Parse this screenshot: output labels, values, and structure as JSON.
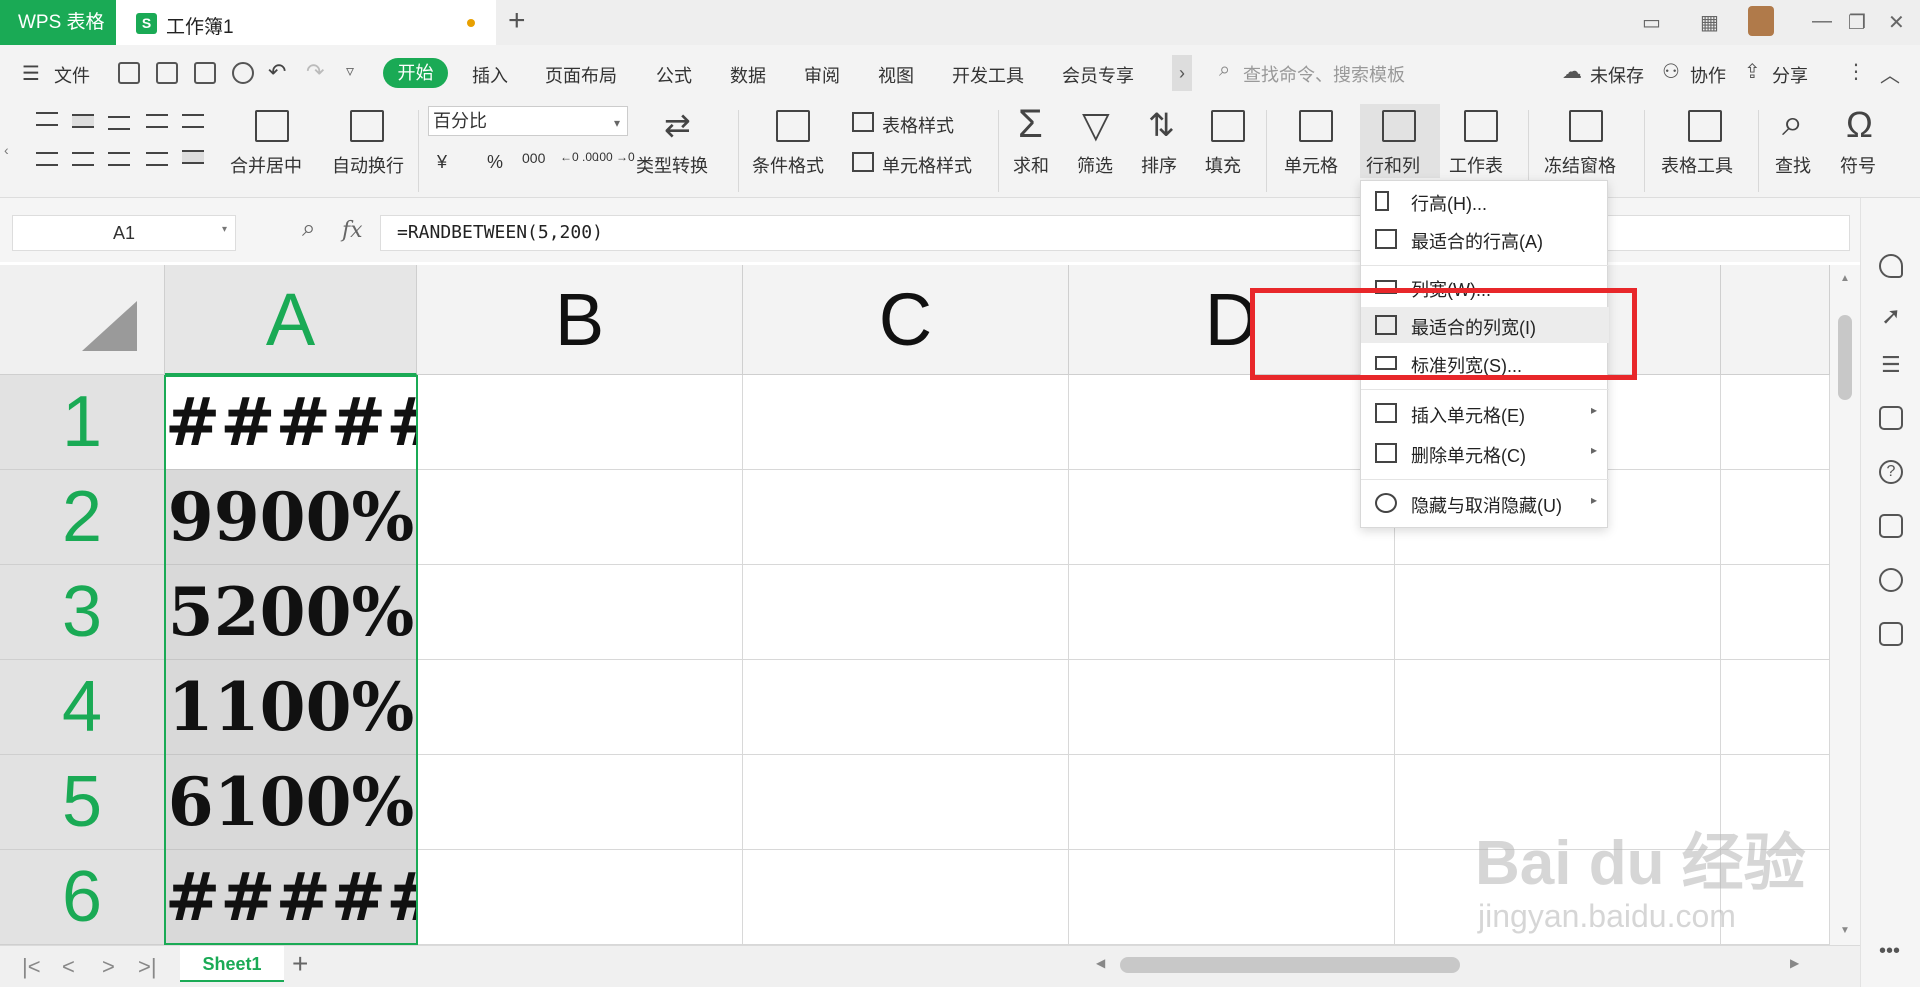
{
  "titlebar": {
    "app_label": "WPS 表格",
    "doc_icon_letter": "S",
    "doc_name": "工作簿1",
    "new_tab": "+"
  },
  "menu": {
    "file": "文件",
    "tabs": [
      "开始",
      "插入",
      "页面布局",
      "公式",
      "数据",
      "审阅",
      "视图",
      "开发工具",
      "会员专享"
    ],
    "more": "›",
    "search_placeholder": "查找命令、搜索模板",
    "unsaved": "未保存",
    "collab": "协作",
    "share": "分享"
  },
  "ribbon": {
    "merge_center": "合并居中",
    "auto_wrap": "自动换行",
    "number_format": "百分比",
    "currency": "¥",
    "percent": "%",
    "thousands": "000",
    "inc_decimal": "←0 .00",
    "dec_decimal": ".00 →0",
    "type_convert": "类型转换",
    "conditional_format": "条件格式",
    "table_style": "表格样式",
    "cell_style": "单元格样式",
    "sum": "求和",
    "filter": "筛选",
    "sort": "排序",
    "fill": "填充",
    "cell": "单元格",
    "row_col": "行和列",
    "worksheet": "工作表",
    "freeze": "冻结窗格",
    "table_tools": "表格工具",
    "find": "查找",
    "symbol": "符号"
  },
  "formula_bar": {
    "cell_ref": "A1",
    "fx": "fx",
    "formula": "=RANDBETWEEN(5,200)"
  },
  "grid": {
    "columns": [
      "A",
      "B",
      "C",
      "D"
    ],
    "rows": [
      {
        "num": "1",
        "a": "#####"
      },
      {
        "num": "2",
        "a": "9900%"
      },
      {
        "num": "3",
        "a": "5200%"
      },
      {
        "num": "4",
        "a": "1100%"
      },
      {
        "num": "5",
        "a": "6100%"
      },
      {
        "num": "6",
        "a": "#####"
      }
    ]
  },
  "dropdown": {
    "items": [
      {
        "label": "行高(H)...",
        "submenu": false
      },
      {
        "label": "最适合的行高(A)",
        "submenu": false
      },
      {
        "label": "列宽(W)...",
        "submenu": false
      },
      {
        "label": "最适合的列宽(I)",
        "submenu": false
      },
      {
        "label": "标准列宽(S)...",
        "submenu": false
      },
      {
        "label": "插入单元格(E)",
        "submenu": true
      },
      {
        "label": "删除单元格(C)",
        "submenu": true
      },
      {
        "label": "隐藏与取消隐藏(U)",
        "submenu": true
      }
    ],
    "highlighted": "最适合的列宽(I)"
  },
  "sheets": {
    "active": "Sheet1",
    "add": "+"
  },
  "watermark": {
    "brand": "Bai du 经验",
    "url": "jingyan.baidu.com"
  },
  "colors": {
    "accent": "#1aaa55",
    "highlight_box": "#e8272a",
    "cell_fill": "#d9d9d9"
  }
}
